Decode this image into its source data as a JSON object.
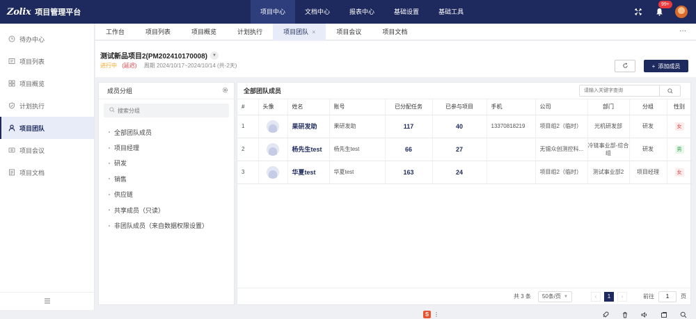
{
  "app": {
    "brand": "Zolix",
    "name": "项目管理平台"
  },
  "topnav": [
    {
      "label": "项目中心",
      "active": true
    },
    {
      "label": "文档中心"
    },
    {
      "label": "报表中心"
    },
    {
      "label": "基础设置"
    },
    {
      "label": "基础工具"
    }
  ],
  "notifications": {
    "count": "99+"
  },
  "sidebar": {
    "items": [
      {
        "label": "待办中心",
        "icon": "clock-icon"
      },
      {
        "label": "项目列表",
        "icon": "list-icon"
      },
      {
        "label": "项目概览",
        "icon": "grid-icon"
      },
      {
        "label": "计划执行",
        "icon": "shield-check-icon"
      },
      {
        "label": "项目团队",
        "icon": "user-icon",
        "active": true
      },
      {
        "label": "项目会议",
        "icon": "meeting-icon"
      },
      {
        "label": "项目文档",
        "icon": "document-icon"
      }
    ]
  },
  "tabs": [
    {
      "label": "工作台"
    },
    {
      "label": "项目列表"
    },
    {
      "label": "项目概览"
    },
    {
      "label": "计划执行"
    },
    {
      "label": "项目团队",
      "active": true,
      "closable": true
    },
    {
      "label": "项目会议"
    },
    {
      "label": "项目文档"
    }
  ],
  "project": {
    "title": "测试新品项目2(PM202410170008)",
    "status": "进行中",
    "late": "(延迟)",
    "period": "周期 2024/10/17~2024/10/14 (共-2天)"
  },
  "actions": {
    "add_member": "添加成员"
  },
  "groups": {
    "title": "成员分组",
    "search_placeholder": "搜索分组",
    "items": [
      "全部团队成员",
      "项目经理",
      "研发",
      "销售",
      "供应链",
      "共享成员（只读）",
      "非团队成员（来自数据权限设置）"
    ]
  },
  "members": {
    "title": "全部团队成员",
    "search_placeholder": "请输入关键字查询",
    "columns": [
      "#",
      "头像",
      "姓名",
      "账号",
      "已分配任务",
      "已参与项目",
      "手机",
      "公司",
      "部门",
      "分组",
      "性别"
    ],
    "rows": [
      {
        "index": "1",
        "name": "果研发助",
        "account": "果研发助",
        "tasks": "117",
        "projects": "40",
        "phone": "13370818219",
        "company": "项目组2（临时）",
        "dept": "光机研发部",
        "group": "研发",
        "gender": "女"
      },
      {
        "index": "2",
        "name": "杨先生test",
        "account": "杨先生test",
        "tasks": "66",
        "projects": "27",
        "phone": "",
        "company": "无锡众创测控科...",
        "dept": "冷链事业部-综合组",
        "group": "研发",
        "gender": "男"
      },
      {
        "index": "3",
        "name": "华夏test",
        "account": "华夏test",
        "tasks": "163",
        "projects": "24",
        "phone": "",
        "company": "项目组2（临时）",
        "dept": "测试事业部2",
        "group": "项目经理",
        "gender": "女"
      }
    ]
  },
  "pagination": {
    "total": "共 3 条",
    "page_size": "50条/页",
    "current": "1",
    "goto_label": "前往",
    "goto_value": "1",
    "page_unit": "页"
  },
  "colors": {
    "primary": "#1e2a5e",
    "warning": "#f5a623",
    "danger": "#e8393d",
    "success": "#3aa24a"
  }
}
